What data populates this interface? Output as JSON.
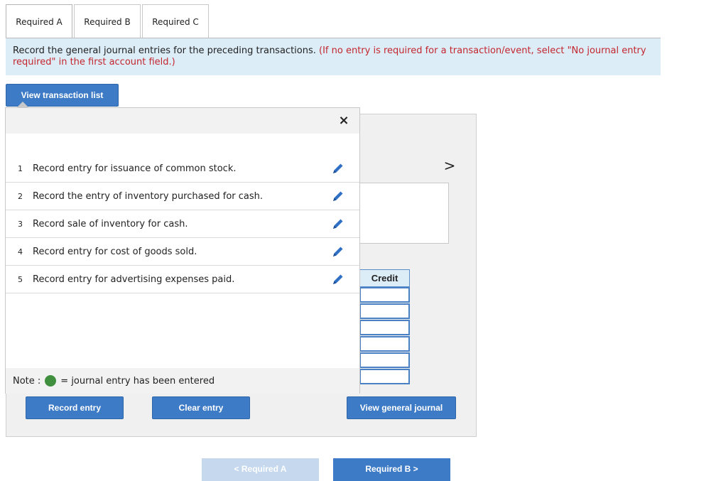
{
  "tabs": [
    {
      "label": "Required A",
      "active": true
    },
    {
      "label": "Required B",
      "active": false
    },
    {
      "label": "Required C",
      "active": false
    }
  ],
  "instruction": {
    "main": "Record the general journal entries for the preceding transactions.",
    "note": "(If no entry is required for a transaction/event, select \"No journal entry required\" in the first account field.)"
  },
  "buttons": {
    "view_transaction_list": "View transaction list",
    "record_entry": "Record entry",
    "clear_entry": "Clear entry",
    "view_general_journal": "View general journal"
  },
  "popup": {
    "close_symbol": "×",
    "transactions": [
      {
        "num": "1",
        "text": "Record entry for issuance of common stock."
      },
      {
        "num": "2",
        "text": "Record the entry of inventory purchased for cash."
      },
      {
        "num": "3",
        "text": "Record sale of inventory for cash."
      },
      {
        "num": "4",
        "text": "Record entry for cost of goods sold."
      },
      {
        "num": "5",
        "text": "Record entry for advertising expenses paid."
      }
    ],
    "note_label": "Note :",
    "note_text": "= journal entry has been entered"
  },
  "journal": {
    "next_symbol": ">",
    "credit_header": "Credit"
  },
  "nav": {
    "prev_label": "< Required A",
    "next_label": "Required B >"
  },
  "colors": {
    "primary_button": "#3d7bc7",
    "banner_bg": "#dcedf8",
    "note_red": "#c4262e",
    "entered_dot": "#3f8f3f",
    "edit_icon": "#2f6fc4"
  },
  "icons": {
    "close": "close-icon",
    "edit": "pencil-icon",
    "next": "chevron-right-icon",
    "entered": "green-dot-icon"
  }
}
